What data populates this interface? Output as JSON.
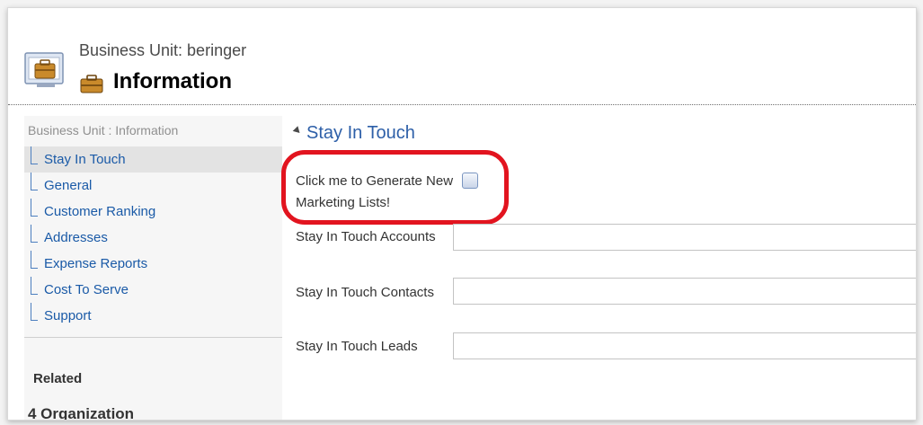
{
  "header": {
    "entity_type_label": "Business Unit: beringer",
    "record_title": "Information",
    "icon_large": "business-unit-icon",
    "icon_small": "briefcase-icon"
  },
  "leftnav": {
    "caption": "Business Unit : Information",
    "items": [
      {
        "label": "Stay In Touch",
        "selected": true
      },
      {
        "label": "General",
        "selected": false
      },
      {
        "label": "Customer Ranking",
        "selected": false
      },
      {
        "label": "Addresses",
        "selected": false
      },
      {
        "label": "Expense Reports",
        "selected": false
      },
      {
        "label": "Cost To Serve",
        "selected": false
      },
      {
        "label": "Support",
        "selected": false
      }
    ],
    "related_heading": "Related",
    "cut_off_text": "4 Organization"
  },
  "section": {
    "title": "Stay In Touch",
    "fields": {
      "generate_label": "Click me to Generate New Marketing Lists!",
      "generate_checked": false,
      "accounts_label": "Stay In Touch Accounts",
      "accounts_value": "",
      "contacts_label": "Stay In Touch Contacts",
      "contacts_value": "",
      "leads_label": "Stay In Touch Leads",
      "leads_value": ""
    }
  },
  "colors": {
    "link_blue": "#1a5aa7",
    "section_title_blue": "#2d5fa8",
    "highlight_red": "#e2141f",
    "nav_selected_bg": "#e3e3e3"
  }
}
